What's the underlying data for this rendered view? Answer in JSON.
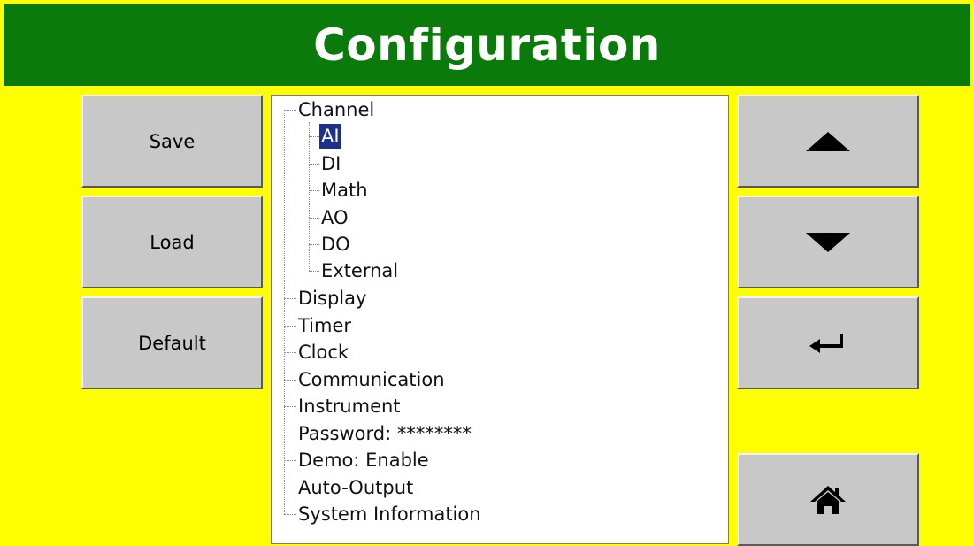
{
  "header": {
    "title": "Configuration"
  },
  "left_buttons": {
    "save": "Save",
    "load": "Load",
    "default": "Default"
  },
  "tree": {
    "root_items": [
      "Channel",
      "Display",
      "Timer",
      "Clock",
      "Communication",
      "Instrument",
      "Password: ********",
      "Demo: Enable",
      "Auto-Output",
      "System Information"
    ],
    "channel_children": [
      "AI",
      "DI",
      "Math",
      "AO",
      "DO",
      "External"
    ],
    "selected": "AI"
  },
  "right_buttons": {
    "up": "up-arrow-icon",
    "down": "down-arrow-icon",
    "enter": "enter-icon",
    "home": "home-icon"
  },
  "colors": {
    "background": "#ffff00",
    "header": "#0a7a0a",
    "button": "#c8c8c8",
    "selection": "#1e2f8c"
  }
}
